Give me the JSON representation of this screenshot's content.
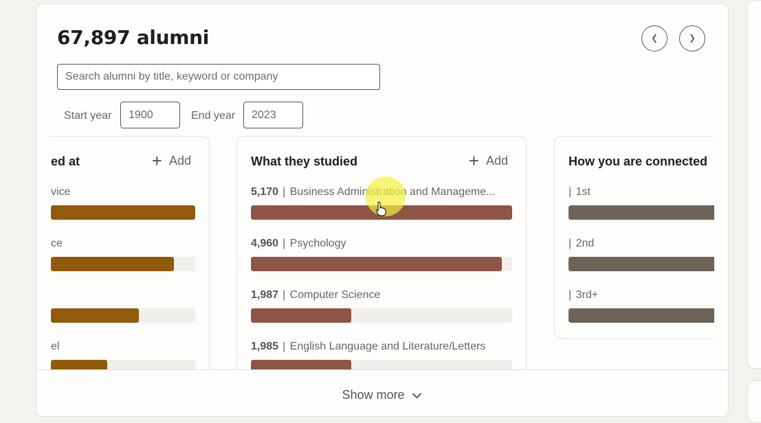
{
  "header": {
    "title": "67,897 alumni",
    "prev_label": "‹",
    "next_label": "›"
  },
  "search": {
    "placeholder": "Search alumni by title, keyword or company",
    "value": ""
  },
  "years": {
    "start_label": "Start year",
    "start_value": "1900",
    "end_label": "End year",
    "end_value": "2023"
  },
  "panels": [
    {
      "title": "Where they worked at",
      "visible_title_fragment": "ed at",
      "add_label": "Add",
      "color": "#925a0d",
      "rows": [
        {
          "label_fragment": "vice",
          "fill": 1.0
        },
        {
          "label_fragment": "ce",
          "fill": 0.85
        },
        {
          "label_fragment": "",
          "fill": 0.61
        },
        {
          "label_fragment": "el",
          "fill": 0.39
        }
      ]
    },
    {
      "title": "What they studied",
      "add_label": "Add",
      "color": "#8f5648",
      "rows": [
        {
          "count": "5,170",
          "label": "Business Administration and Manageme...",
          "fill": 1.0
        },
        {
          "count": "4,960",
          "label": "Psychology",
          "fill": 0.96
        },
        {
          "count": "1,987",
          "label": "Computer Science",
          "fill": 0.384
        },
        {
          "count": "1,985",
          "label": "English Language and Literature/Letters",
          "fill": 0.384
        }
      ]
    },
    {
      "title": "How you are connected",
      "color": "#6e6357",
      "rows": [
        {
          "count": "",
          "label": "1st",
          "fill": 1.0
        },
        {
          "count": "",
          "label": "2nd",
          "fill": 1.0
        },
        {
          "count": "",
          "label": "3rd+",
          "fill": 1.0
        }
      ]
    }
  ],
  "footer": {
    "show_more_label": "Show more"
  }
}
